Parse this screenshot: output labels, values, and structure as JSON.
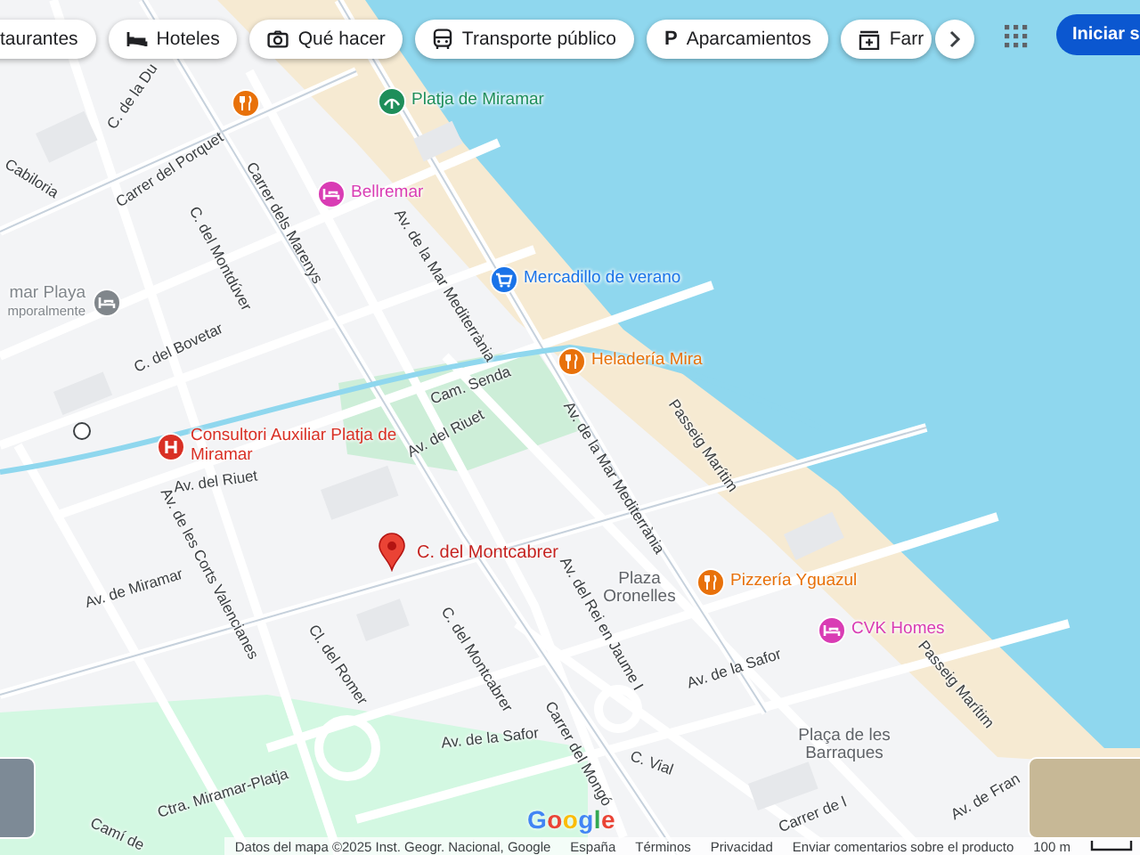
{
  "category_chips": [
    {
      "label": "taurantes",
      "kind": "restaurants"
    },
    {
      "label": "Hoteles",
      "kind": "hotels"
    },
    {
      "label": "Qué hacer",
      "kind": "activities"
    },
    {
      "label": "Transporte público",
      "kind": "transit"
    },
    {
      "label": "Aparcamientos",
      "kind": "parking",
      "icon_text": "P"
    },
    {
      "label": "Farr",
      "kind": "pharmacy"
    }
  ],
  "sign_in_button": "Iniciar s",
  "streets": [
    {
      "name": "C. de la Du"
    },
    {
      "name": "Carrer del Porquet"
    },
    {
      "name": "Carrer dels Marenys"
    },
    {
      "name": "Cabiloria"
    },
    {
      "name": "C. del Montdúver"
    },
    {
      "name": "C. del Bovetar"
    },
    {
      "name": "Av. de la Mar Mediterrània"
    },
    {
      "name": "Cam. Senda"
    },
    {
      "name": "Av. del Riuet"
    },
    {
      "name": "Passeig Marítim"
    },
    {
      "name": "Av. de la Mar Mediterrània"
    },
    {
      "name": "Av. del Riuet"
    },
    {
      "name": "Av. de Miramar"
    },
    {
      "name": "Av. de les Corts Valencianes"
    },
    {
      "name": "Cl. del Romer"
    },
    {
      "name": "C. del Montcabrer"
    },
    {
      "name": "Av. del Rei en Jaume I"
    },
    {
      "name": "Av. de la Safor"
    },
    {
      "name": "Av. de la Safor"
    },
    {
      "name": "C. Vial"
    },
    {
      "name": "Carrer del Mongó"
    },
    {
      "name": "Carrer de l"
    },
    {
      "name": "Av. de Fran"
    },
    {
      "name": "Passeig Marítim"
    },
    {
      "name": "Ctra. Miramar-Platja"
    },
    {
      "name": "Camí de"
    }
  ],
  "areas": [
    {
      "lines": [
        "Plaza",
        "Oronelles"
      ]
    },
    {
      "lines": [
        "Plaça de les",
        "Barraques"
      ]
    }
  ],
  "places": [
    {
      "name": "Platja de Miramar",
      "kind": "beach",
      "color": "#1e8e5a"
    },
    {
      "name": "Bellremar",
      "kind": "hotel",
      "color": "#d93cb4"
    },
    {
      "name": "Mercadillo de verano",
      "kind": "shop",
      "color": "#1a73e8"
    },
    {
      "name": "Heladería Mira",
      "kind": "restaurant",
      "color": "#e8710a"
    },
    {
      "name": "Consultori Auxiliar Platja de Miramar",
      "kind": "hospital",
      "color": "#d93025"
    },
    {
      "name": "Pizzería Yguazul",
      "kind": "restaurant",
      "color": "#e8710a"
    },
    {
      "name": "CVK Homes",
      "kind": "hotel",
      "color": "#d93cb4"
    },
    {
      "name": "mar Playa",
      "note": "mporalmente",
      "kind": "hotel",
      "color": "#80868b"
    },
    {
      "kind": "restaurant",
      "color": "#e8710a"
    }
  ],
  "selected_place": {
    "name": "C. del Montcabrer"
  },
  "logo": "Google",
  "footer": [
    "Datos del mapa ©2025 Inst. Geogr. Nacional, Google",
    "España",
    "Términos",
    "Privacidad",
    "Enviar comentarios sobre el producto"
  ],
  "scale": "100 m"
}
